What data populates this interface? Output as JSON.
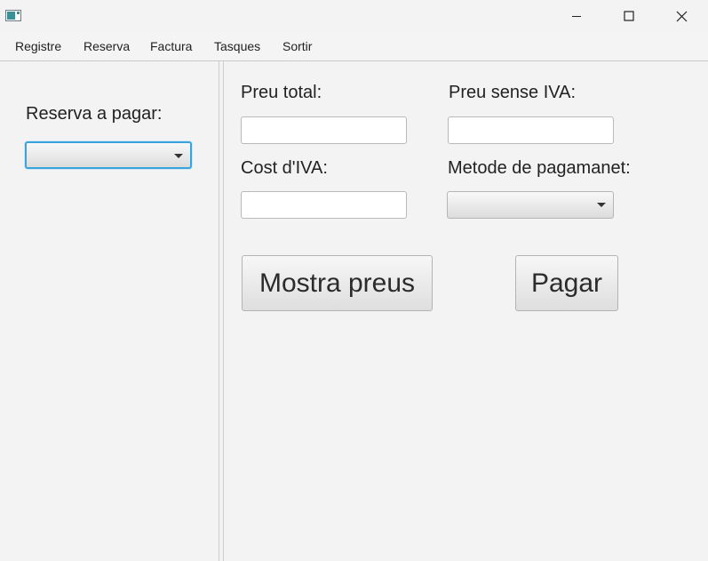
{
  "window": {
    "controls": {
      "minimize_icon": "minimize-icon",
      "maximize_icon": "maximize-icon",
      "close_icon": "close-icon"
    }
  },
  "menu": {
    "items": [
      "Registre",
      "Reserva",
      "Factura",
      "Tasques",
      "Sortir"
    ]
  },
  "left": {
    "reservation_label": "Reserva a pagar:",
    "reservation_selected": ""
  },
  "form": {
    "total_label": "Preu total:",
    "total_value": "",
    "no_vat_label": "Preu sense IVA:",
    "no_vat_value": "",
    "vat_label": "Cost d'IVA:",
    "vat_value": "",
    "payment_label": "Metode de pagamanet:",
    "payment_selected": ""
  },
  "buttons": {
    "show_prices": "Mostra preus",
    "pay": "Pagar"
  },
  "colors": {
    "focus_accent": "#3aa3dc",
    "background": "#f3f3f3"
  }
}
